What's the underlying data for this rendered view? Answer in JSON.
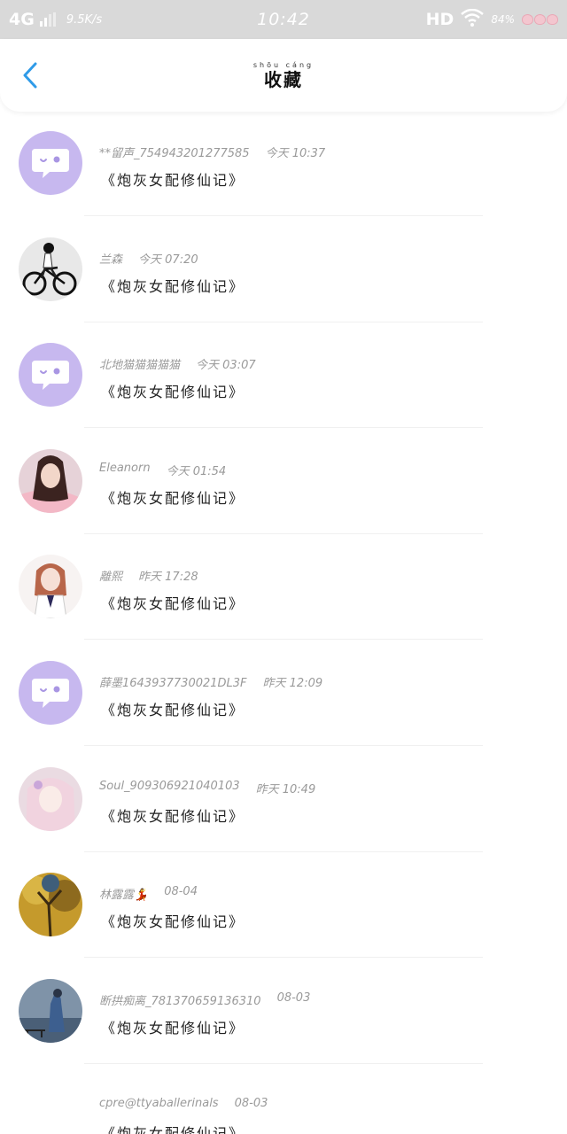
{
  "status_bar": {
    "network": "4G",
    "speed": "9.5K/s",
    "time": "10:42",
    "hd": "HD",
    "battery": "84%"
  },
  "header": {
    "title_ruby": "shōu cáng",
    "title": "收藏",
    "back_icon": "chevron-left-icon",
    "accent_color": "#2f9be8"
  },
  "feed": {
    "items": [
      {
        "nick": "**留声_754943201277585",
        "time": "今天 10:37",
        "content": "《炮灰女配修仙记》",
        "avatar": "chat-bubble-avatar"
      },
      {
        "nick": "兰森",
        "time": "今天 07:20",
        "content": "《炮灰女配修仙记》",
        "avatar": "bicycle-photo-avatar"
      },
      {
        "nick": "北地猫猫猫猫猫",
        "time": "今天 03:07",
        "content": "《炮灰女配修仙记》",
        "avatar": "chat-bubble-avatar"
      },
      {
        "nick": "Eleanorn",
        "time": "今天 01:54",
        "content": "《炮灰女配修仙记》",
        "avatar": "girl-photo-avatar"
      },
      {
        "nick": "離熙",
        "time": "昨天 17:28",
        "content": "《炮灰女配修仙记》",
        "avatar": "anime-girl-avatar"
      },
      {
        "nick": "薛墨1643937730021DL3F",
        "time": "昨天 12:09",
        "content": "《炮灰女配修仙记》",
        "avatar": "chat-bubble-avatar"
      },
      {
        "nick": "Soul_909306921040103",
        "time": "昨天 10:49",
        "content": "《炮灰女配修仙记》",
        "avatar": "anime-pink-avatar"
      },
      {
        "nick": "林露露💃",
        "time": "08-04",
        "content": "《炮灰女配修仙记》",
        "avatar": "autumn-tree-avatar"
      },
      {
        "nick": "断拱痴离_781370659136310",
        "time": "08-03",
        "content": "《炮灰女配修仙记》",
        "avatar": "blue-figure-avatar"
      },
      {
        "nick": "cpre@ttyaballerinals",
        "time": "08-03",
        "content": "《炮灰女配修仙记》",
        "avatar": ""
      }
    ]
  }
}
